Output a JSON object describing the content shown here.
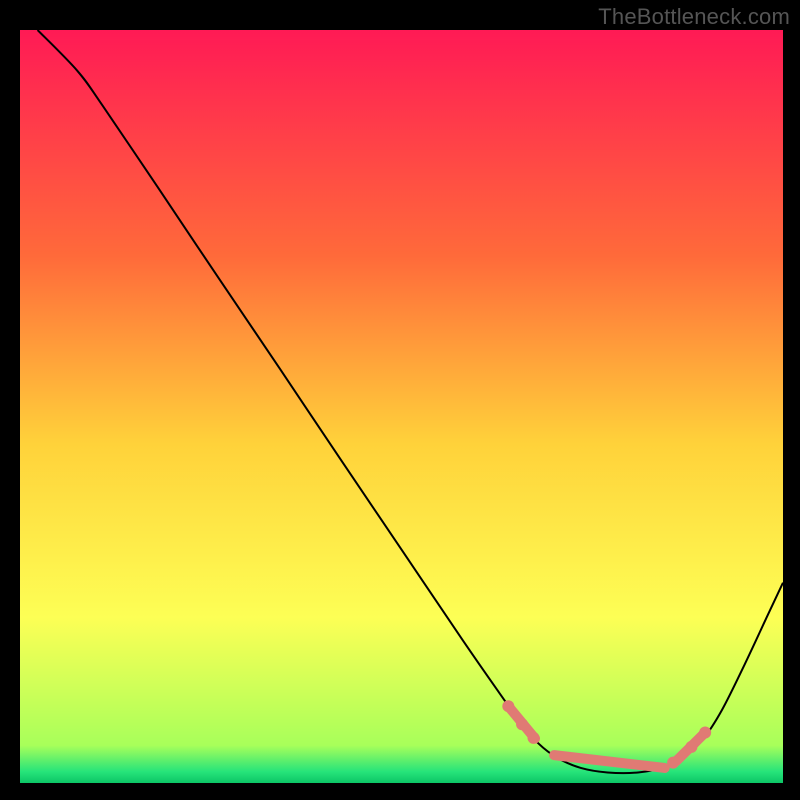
{
  "attribution": "TheBottleneck.com",
  "chart_data": {
    "type": "line",
    "xlim": [
      0,
      1
    ],
    "ylim": [
      0,
      1
    ],
    "xlabel": "",
    "ylabel": "",
    "title": "",
    "grid": false,
    "background_gradient": {
      "direction": "vertical",
      "stops": [
        {
          "offset": 0.0,
          "color": "#ff1a55"
        },
        {
          "offset": 0.3,
          "color": "#ff6a3a"
        },
        {
          "offset": 0.55,
          "color": "#ffd23a"
        },
        {
          "offset": 0.78,
          "color": "#fdff55"
        },
        {
          "offset": 0.95,
          "color": "#a8ff5a"
        },
        {
          "offset": 0.985,
          "color": "#26e47a"
        },
        {
          "offset": 1.0,
          "color": "#0cc566"
        }
      ]
    },
    "series": [
      {
        "name": "curve",
        "color": "#000000",
        "width": 2,
        "points": [
          {
            "x": 0.023,
            "y": 1.0
          },
          {
            "x": 0.075,
            "y": 0.946
          },
          {
            "x": 0.108,
            "y": 0.9
          },
          {
            "x": 0.18,
            "y": 0.792
          },
          {
            "x": 0.26,
            "y": 0.671
          },
          {
            "x": 0.34,
            "y": 0.551
          },
          {
            "x": 0.42,
            "y": 0.43
          },
          {
            "x": 0.5,
            "y": 0.31
          },
          {
            "x": 0.58,
            "y": 0.19
          },
          {
            "x": 0.628,
            "y": 0.12
          },
          {
            "x": 0.655,
            "y": 0.082
          },
          {
            "x": 0.68,
            "y": 0.052
          },
          {
            "x": 0.705,
            "y": 0.033
          },
          {
            "x": 0.735,
            "y": 0.02
          },
          {
            "x": 0.77,
            "y": 0.014
          },
          {
            "x": 0.81,
            "y": 0.014
          },
          {
            "x": 0.845,
            "y": 0.021
          },
          {
            "x": 0.87,
            "y": 0.034
          },
          {
            "x": 0.895,
            "y": 0.058
          },
          {
            "x": 0.92,
            "y": 0.097
          },
          {
            "x": 0.95,
            "y": 0.158
          },
          {
            "x": 0.98,
            "y": 0.223
          },
          {
            "x": 1.0,
            "y": 0.266
          }
        ]
      }
    ],
    "markers": {
      "color": "#e07a74",
      "dots": [
        {
          "x": 0.64,
          "y": 0.102
        },
        {
          "x": 0.658,
          "y": 0.078
        },
        {
          "x": 0.673,
          "y": 0.06
        },
        {
          "x": 0.856,
          "y": 0.027
        },
        {
          "x": 0.88,
          "y": 0.048
        },
        {
          "x": 0.898,
          "y": 0.067
        }
      ],
      "pills": [
        {
          "x1": 0.64,
          "y1": 0.102,
          "x2": 0.675,
          "y2": 0.059
        },
        {
          "x1": 0.7,
          "y1": 0.037,
          "x2": 0.845,
          "y2": 0.02
        },
        {
          "x1": 0.86,
          "y1": 0.029,
          "x2": 0.896,
          "y2": 0.065
        }
      ]
    }
  }
}
